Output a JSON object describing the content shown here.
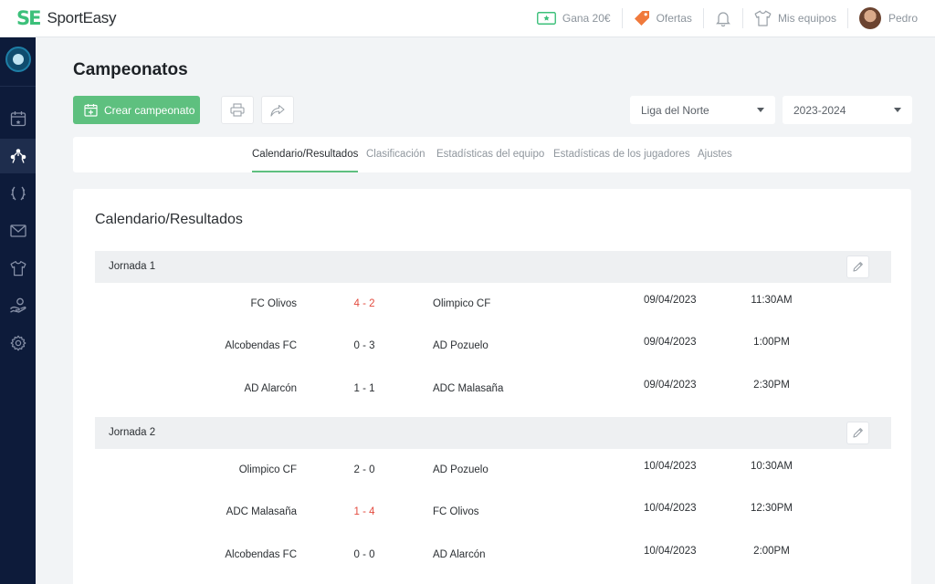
{
  "app": {
    "logo_mark": "SE",
    "logo_text": "SportEasy"
  },
  "topnav": {
    "earn": "Gana 20€",
    "offers": "Ofertas",
    "my_teams": "Mis equipos",
    "user": "Pedro"
  },
  "sidebar": {
    "items": [
      {
        "icon": "calendar-icon"
      },
      {
        "icon": "team-icon",
        "active": true
      },
      {
        "icon": "laurel-icon"
      },
      {
        "icon": "mail-icon"
      },
      {
        "icon": "shirt-icon"
      },
      {
        "icon": "hand-coin-icon"
      },
      {
        "icon": "gear-icon"
      }
    ]
  },
  "page": {
    "title": "Campeonatos",
    "create_button": "Crear campeonato",
    "league_select": "Liga del Norte",
    "season_select": "2023-2024"
  },
  "tabs": [
    {
      "label": "Calendario/Resultados",
      "active": true
    },
    {
      "label": "Clasificación"
    },
    {
      "label": "Estadísticas del equipo"
    },
    {
      "label": "Estadísticas de los jugadores"
    },
    {
      "label": "Ajustes"
    }
  ],
  "card": {
    "title": "Calendario/Resultados"
  },
  "rounds": [
    {
      "label": "Jornada 1",
      "matches": [
        {
          "home": "FC Olivos",
          "score": "4 - 2",
          "away": "Olimpico CF",
          "date": "09/04/2023",
          "time": "11:30AM",
          "highlight": true
        },
        {
          "home": "Alcobendas FC",
          "score": "0 - 3",
          "away": "AD Pozuelo",
          "date": "09/04/2023",
          "time": "1:00PM",
          "highlight": false
        },
        {
          "home": "AD Alarcón",
          "score": "1 - 1",
          "away": "ADC Malasaña",
          "date": "09/04/2023",
          "time": "2:30PM",
          "highlight": false
        }
      ]
    },
    {
      "label": "Jornada 2",
      "matches": [
        {
          "home": "Olimpico CF",
          "score": "2 - 0",
          "away": "AD Pozuelo",
          "date": "10/04/2023",
          "time": "10:30AM",
          "highlight": false
        },
        {
          "home": "ADC Malasaña",
          "score": "1 - 4",
          "away": "FC Olivos",
          "date": "10/04/2023",
          "time": "12:30PM",
          "highlight": true
        },
        {
          "home": "Alcobendas FC",
          "score": "0 - 0",
          "away": "AD Alarcón",
          "date": "10/04/2023",
          "time": "2:00PM",
          "highlight": false
        }
      ]
    }
  ],
  "colors": {
    "brand_green": "#5ec07f",
    "sidebar_bg": "#0d1b3a",
    "highlight_score": "#e34b3f",
    "offers_orange": "#f07a3c"
  }
}
